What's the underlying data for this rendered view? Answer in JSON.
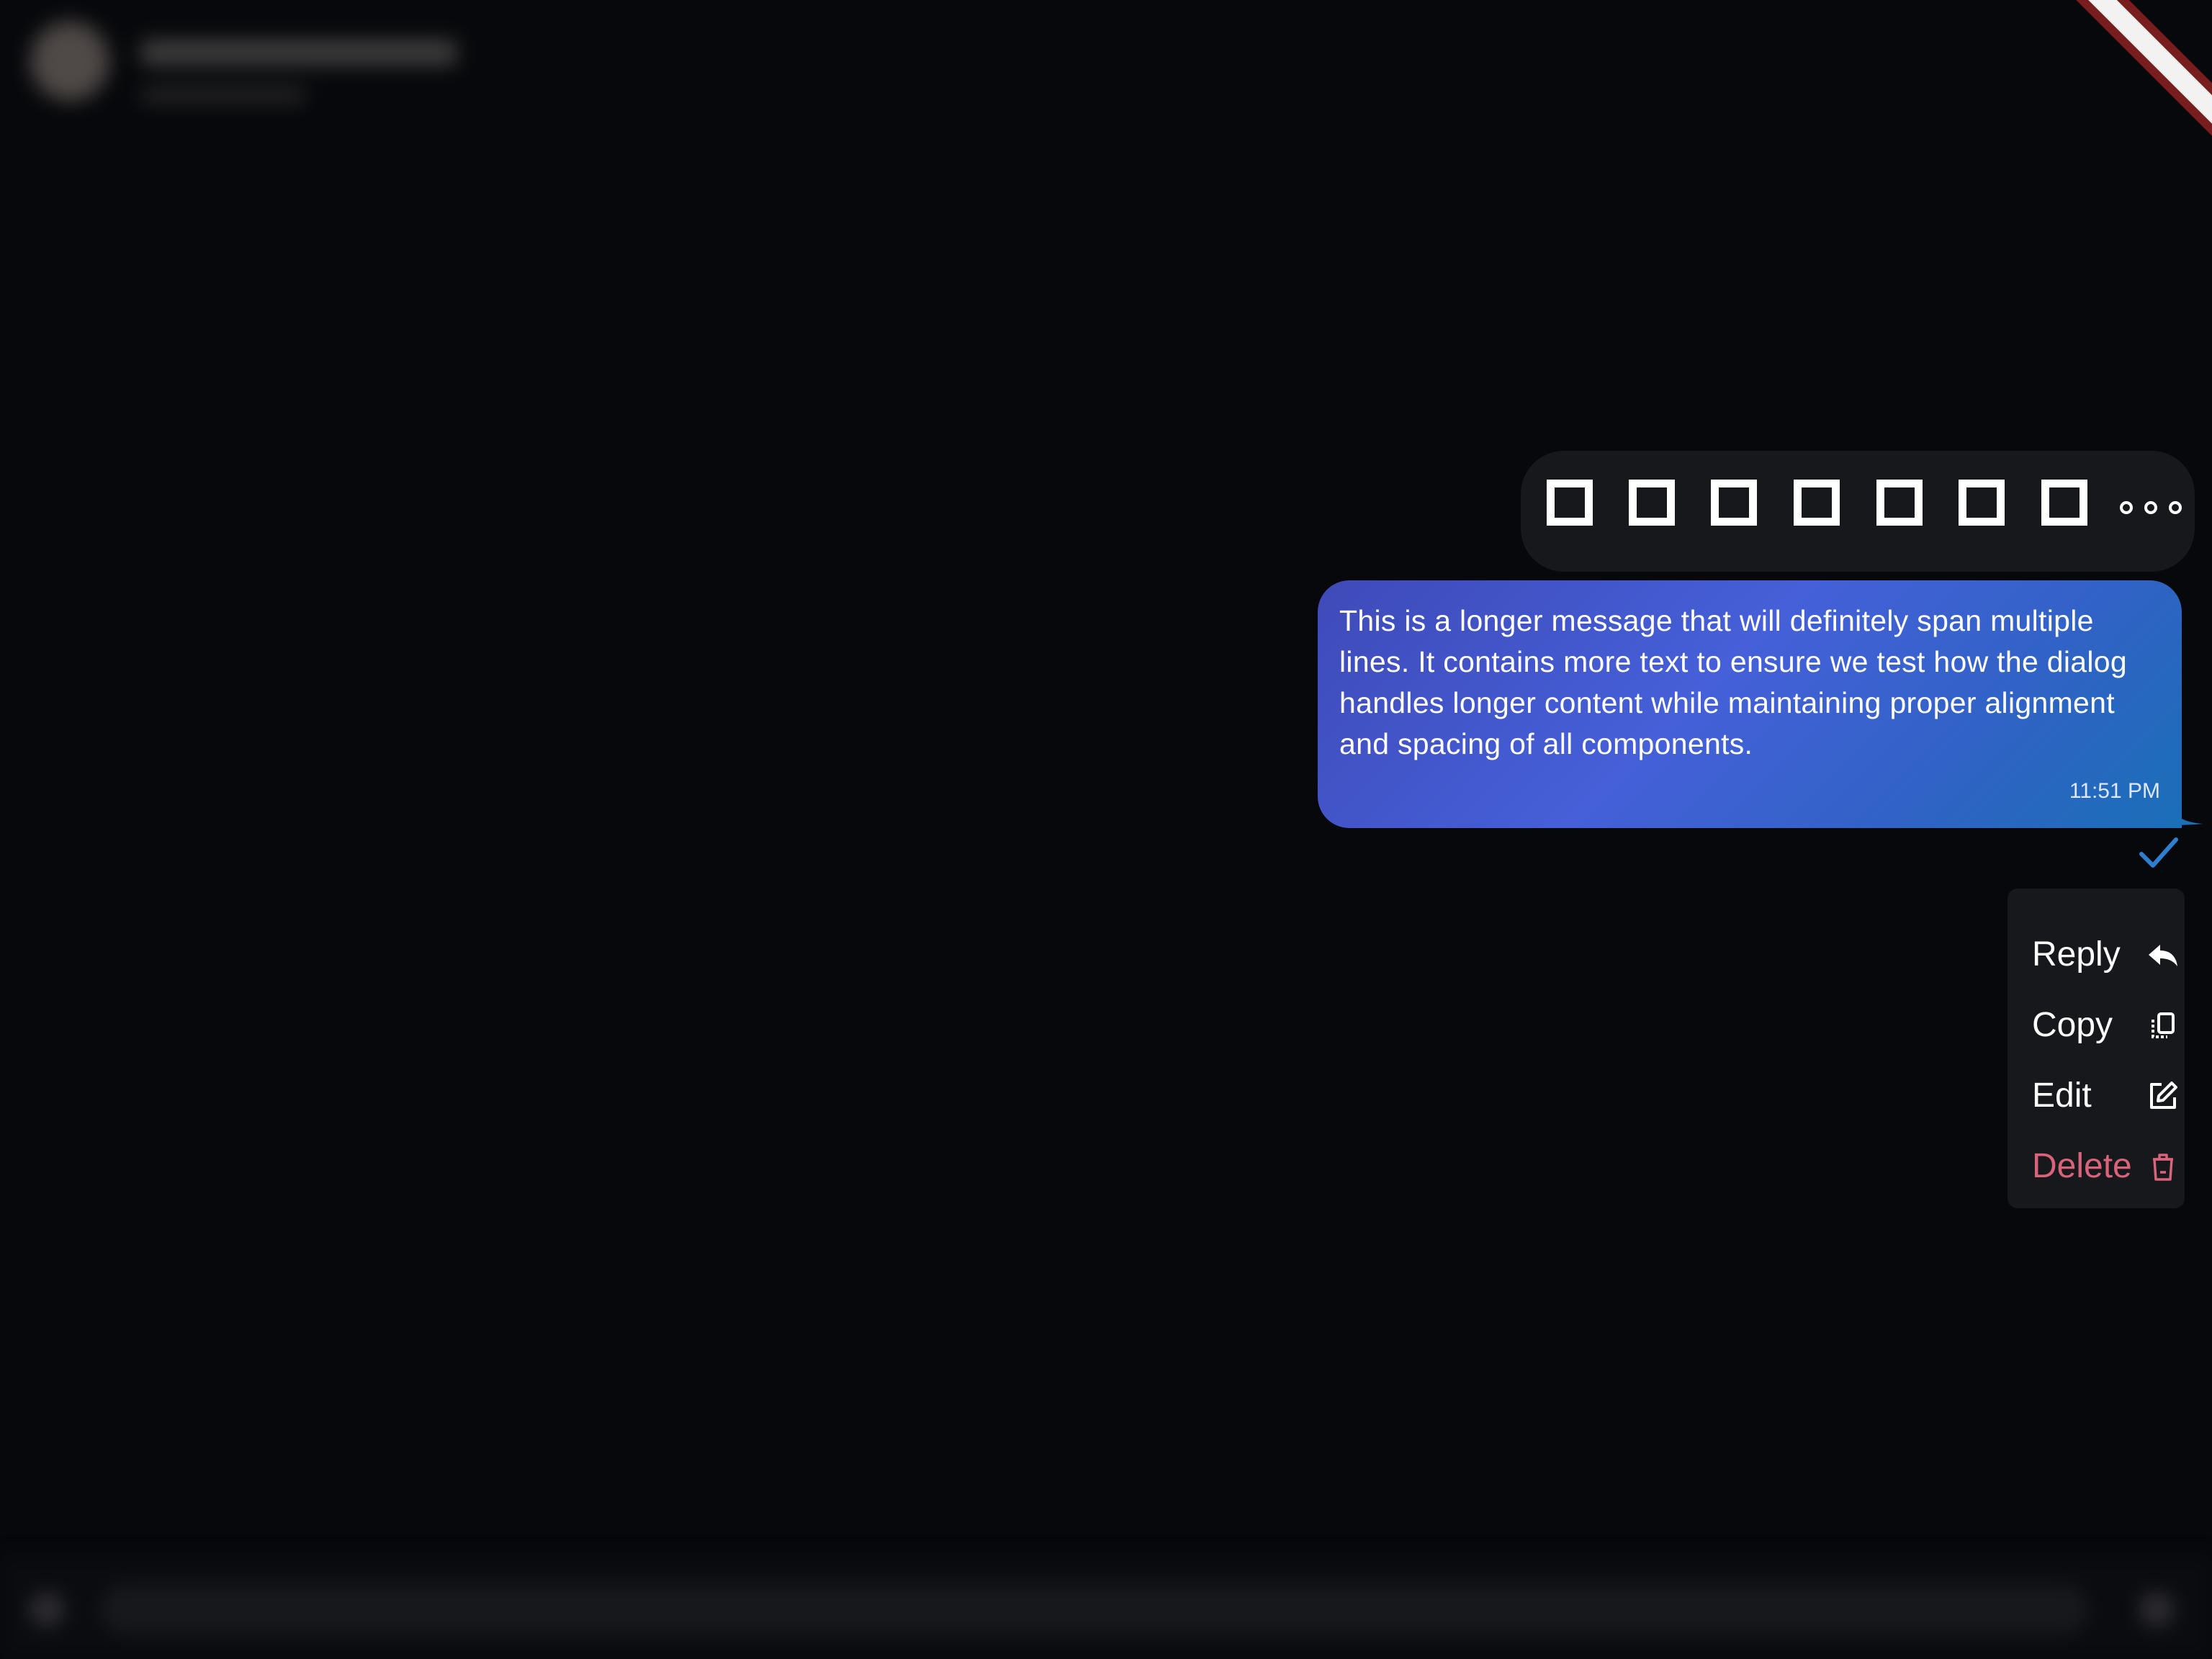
{
  "header": {
    "contact_name": "",
    "contact_status": ""
  },
  "reactions": {
    "items": [
      {
        "icon": "missing-glyph-box"
      },
      {
        "icon": "missing-glyph-box"
      },
      {
        "icon": "missing-glyph-box"
      },
      {
        "icon": "missing-glyph-box"
      },
      {
        "icon": "missing-glyph-box"
      },
      {
        "icon": "missing-glyph-box"
      },
      {
        "icon": "missing-glyph-box"
      }
    ],
    "more_icon": "more-horizontal-icon"
  },
  "message": {
    "text": "This is a longer message that will definitely span multiple lines. It contains more text to ensure we test how the dialog handles longer content while maintaining proper alignment and spacing of all components.",
    "time": "11:51 PM",
    "status_icon": "check-icon"
  },
  "menu": {
    "items": [
      {
        "label": "Reply",
        "icon": "reply-icon"
      },
      {
        "label": "Copy",
        "icon": "copy-icon"
      },
      {
        "label": "Edit",
        "icon": "edit-icon"
      },
      {
        "label": "Delete",
        "icon": "delete-icon",
        "danger": true
      }
    ]
  },
  "composer": {
    "placeholder": ""
  },
  "colors": {
    "background": "#07080b",
    "surface": "#16181c",
    "bubble_gradient_start": "#3f4ab8",
    "bubble_gradient_end": "#1a6fb8",
    "check": "#2f7fd1",
    "danger": "#d9637a"
  }
}
